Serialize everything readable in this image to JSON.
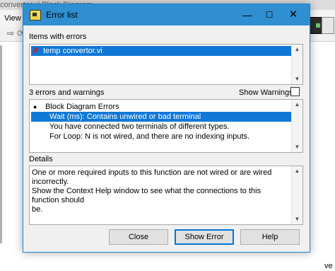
{
  "background": {
    "window_title": "convertor.vi Block Diagram",
    "menu_view": "View",
    "corner_text": "ve"
  },
  "dialog": {
    "title": "Error list",
    "items_label": "Items with errors",
    "items": [
      {
        "icon": "error-x-icon",
        "glyph": "✗",
        "label": "temp convertor.vi",
        "selected": true
      }
    ],
    "count_label": "3 errors and warnings",
    "show_warnings_label": "Show Warnings",
    "show_warnings_checked": false,
    "errors": [
      {
        "text": "Block Diagram Errors",
        "kind": "group",
        "bullet": "●"
      },
      {
        "text": "Wait (ms): Contains unwired or bad terminal",
        "kind": "error",
        "selected": true
      },
      {
        "text": "You have connected two terminals of different types.",
        "kind": "error"
      },
      {
        "text": "For Loop: N is not wired, and there are no indexing inputs.",
        "kind": "error"
      }
    ],
    "details_label": "Details",
    "details_text": "One or more required inputs to this function are not wired or are wired incorrectly.\nShow the Context Help window to see what the connections to this function should\nbe.",
    "buttons": {
      "close": "Close",
      "show_error": "Show Error",
      "help": "Help"
    }
  },
  "colors": {
    "titlebar": "#2f8fd1",
    "selection": "#0f78d7",
    "error_x": "#d61a1a"
  }
}
